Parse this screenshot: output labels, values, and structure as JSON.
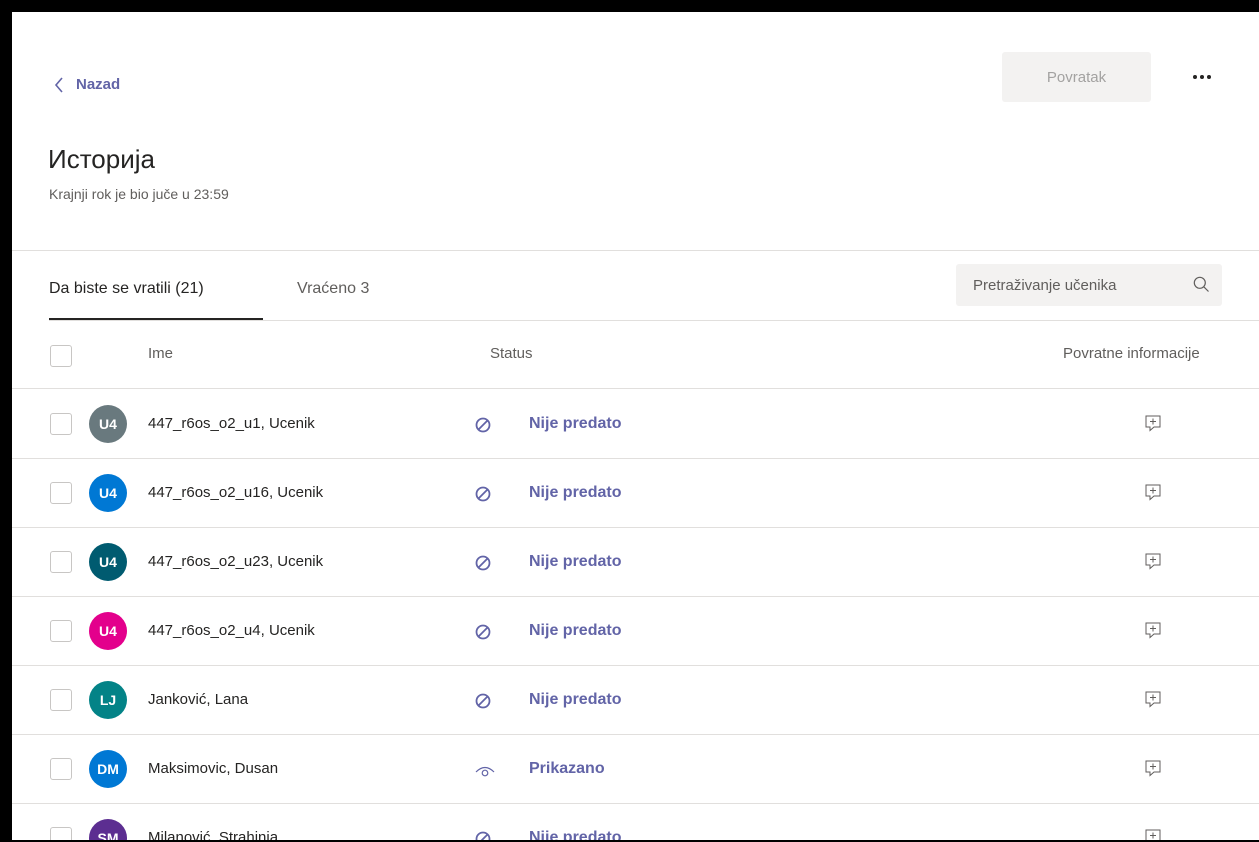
{
  "nav": {
    "back_label": "Nazad"
  },
  "toolbar": {
    "return_label": "Povratak"
  },
  "assignment": {
    "title": "Историја",
    "due_text": "Krajnji rok je bio juče u 23:59"
  },
  "tabs": [
    {
      "label": "Da biste se vratili (21)",
      "active": true
    },
    {
      "label": "Vraćeno 3",
      "active": false
    }
  ],
  "search": {
    "placeholder": "Pretraživanje učenika"
  },
  "table": {
    "columns": {
      "name": "Ime",
      "status": "Status",
      "feedback": "Povratne informacije"
    },
    "rows": [
      {
        "initials": "U4",
        "avatar_color": "#69797e",
        "name": "447_r6os_o2_u1, Ucenik",
        "status": "Nije predato",
        "status_icon": "not-submitted-icon"
      },
      {
        "initials": "U4",
        "avatar_color": "#0078d4",
        "name": "447_r6os_o2_u16, Ucenik",
        "status": "Nije predato",
        "status_icon": "not-submitted-icon"
      },
      {
        "initials": "U4",
        "avatar_color": "#005b70",
        "name": "447_r6os_o2_u23, Ucenik",
        "status": "Nije predato",
        "status_icon": "not-submitted-icon"
      },
      {
        "initials": "U4",
        "avatar_color": "#e3008c",
        "name": "447_r6os_o2_u4, Ucenik",
        "status": "Nije predato",
        "status_icon": "not-submitted-icon"
      },
      {
        "initials": "LJ",
        "avatar_color": "#038387",
        "name": "Janković, Lana",
        "status": "Nije predato",
        "status_icon": "not-submitted-icon"
      },
      {
        "initials": "DM",
        "avatar_color": "#0078d4",
        "name": "Maksimovic, Dusan",
        "status": "Prikazano",
        "status_icon": "viewed-icon"
      },
      {
        "initials": "SM",
        "avatar_color": "#5c2e91",
        "name": "Milanović, Strahinja",
        "status": "Nije predato",
        "status_icon": "not-submitted-icon"
      }
    ]
  },
  "colors": {
    "accent": "#6264a7",
    "text": "#252423",
    "muted": "#605e5c"
  }
}
